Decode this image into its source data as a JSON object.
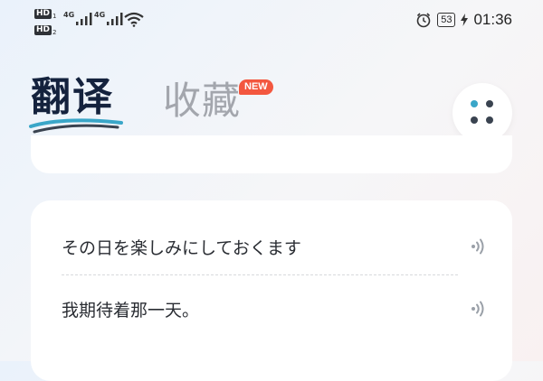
{
  "status_bar": {
    "hd_labels": [
      "HD",
      "HD"
    ],
    "sim_numbers": [
      "1",
      "2"
    ],
    "network_labels": [
      "4G",
      "4G"
    ],
    "time": "01:36",
    "battery_level": "53",
    "icons": [
      "signal-icon",
      "wifi-icon",
      "alarm-icon",
      "charging-bolt-icon"
    ]
  },
  "tabs": {
    "translate_label": "翻译",
    "favorites_label": "收藏",
    "favorites_badge": "NEW",
    "active": "translate"
  },
  "result": {
    "source_text": "その日を楽しみにしておくます",
    "target_text": "我期待着那一天。"
  },
  "colors": {
    "accent_teal": "#3aa6c8",
    "accent_dark": "#3a4350",
    "badge_red": "#f3573f",
    "title_dark": "#14223d",
    "inactive_gray": "#a3a6ad"
  }
}
